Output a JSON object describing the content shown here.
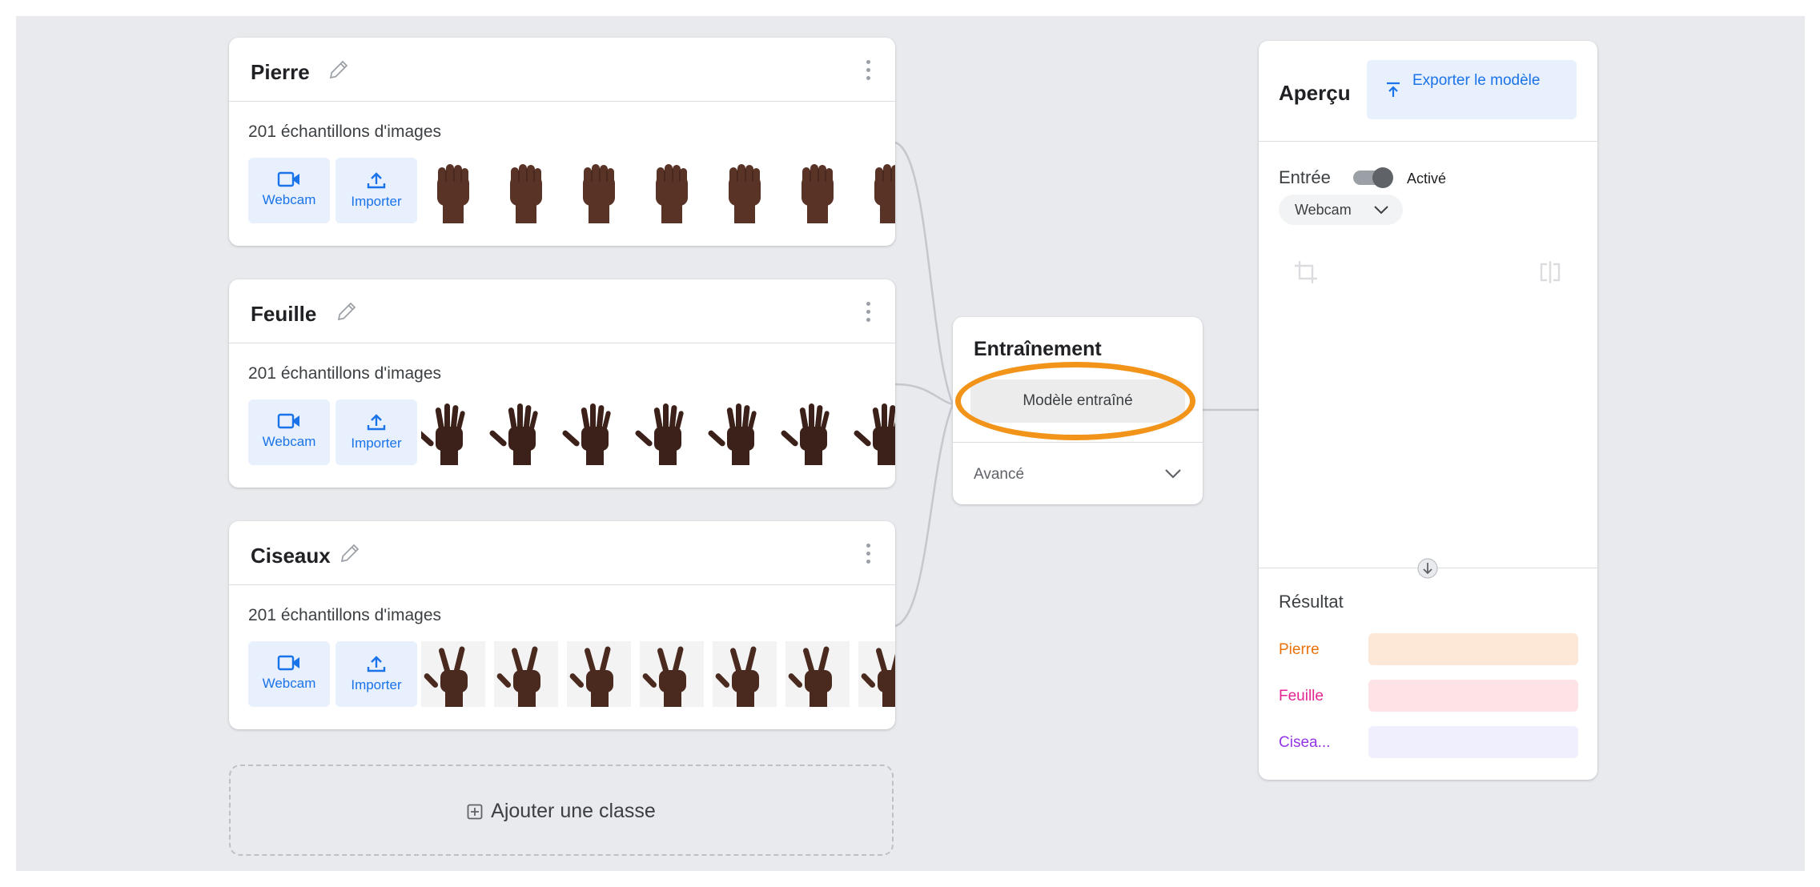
{
  "classes": [
    {
      "name": "Pierre",
      "samples": "201 échantillons d'images",
      "webcam": "Webcam",
      "import": "Importer",
      "gesture": "fist"
    },
    {
      "name": "Feuille",
      "samples": "201 échantillons d'images",
      "webcam": "Webcam",
      "import": "Importer",
      "gesture": "palm"
    },
    {
      "name": "Ciseaux",
      "samples": "201 échantillons d'images",
      "webcam": "Webcam",
      "import": "Importer",
      "gesture": "scissors"
    }
  ],
  "add_class": {
    "label": "Ajouter une classe"
  },
  "training": {
    "title": "Entraînement",
    "button": "Modèle entraîné",
    "advanced": "Avancé"
  },
  "preview": {
    "title": "Aperçu",
    "export": "Exporter le modèle",
    "input_label": "Entrée",
    "toggle_state": "Activé",
    "source": "Webcam",
    "output_label": "Résultat",
    "results": [
      {
        "name": "Pierre",
        "color": "#e8710a",
        "bar_color": "#fde8d8"
      },
      {
        "name": "Feuille",
        "color": "#e52592",
        "bar_color": "#fde3e6"
      },
      {
        "name": "Cisea...",
        "color": "#9334e6",
        "bar_color": "#efeffd"
      }
    ]
  },
  "colors": {
    "accent": "#1a73e8",
    "highlight": "#f29419",
    "skin": "#5a3327"
  }
}
